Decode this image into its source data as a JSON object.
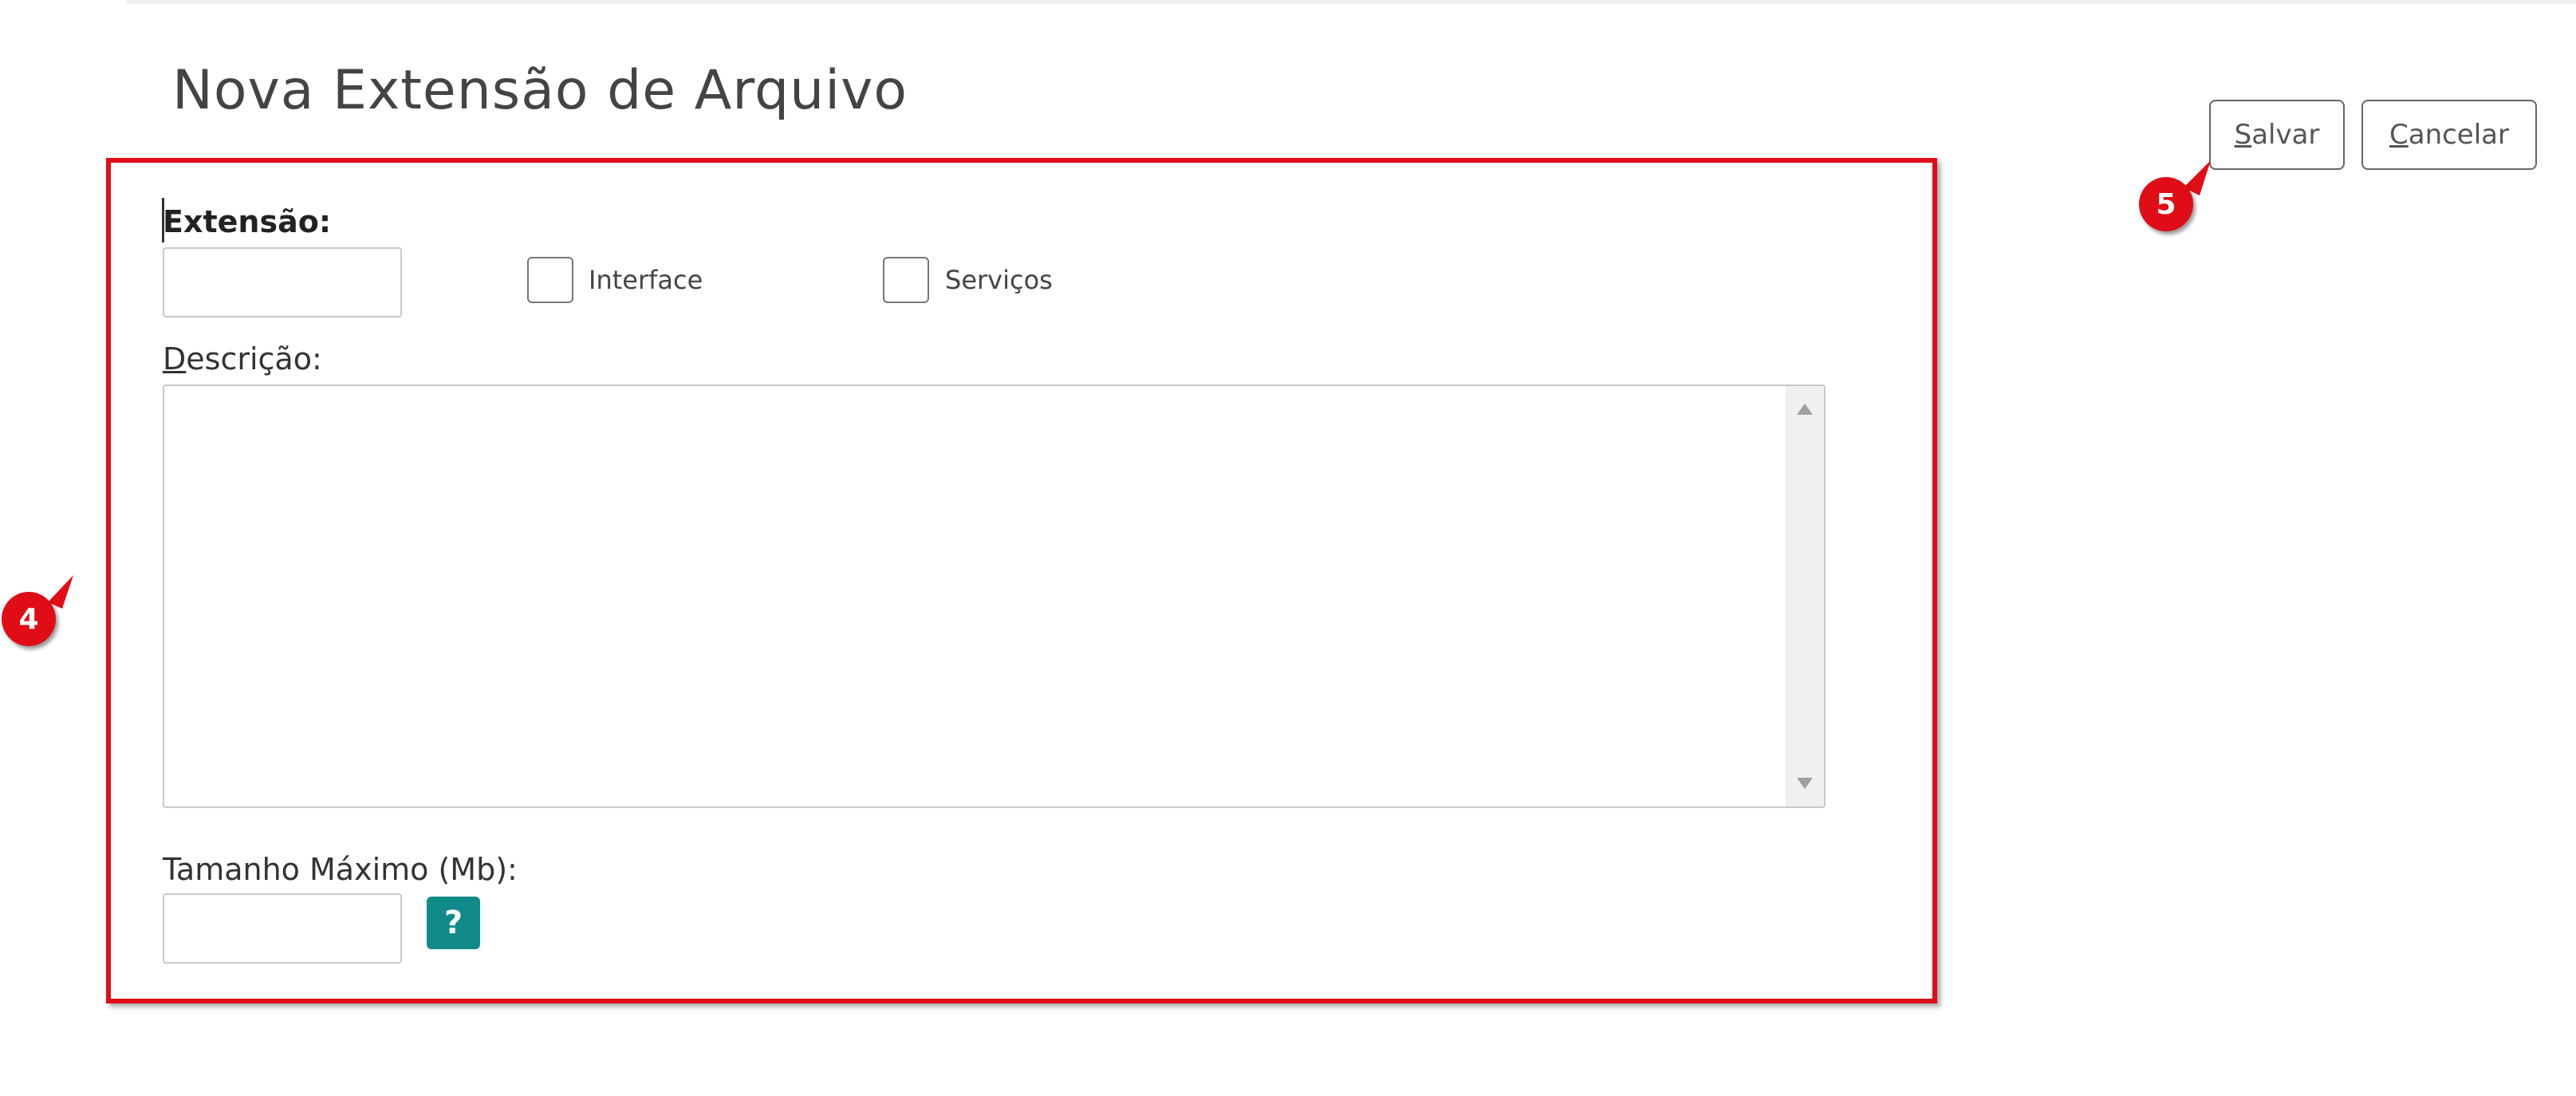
{
  "page": {
    "title": "Nova Extensão de Arquivo"
  },
  "toolbar": {
    "save_first": "S",
    "save_rest": "alvar",
    "cancel_first": "C",
    "cancel_rest": "ancelar"
  },
  "form": {
    "extension_label": "Extensão:",
    "extension_value": "",
    "interface_label": "Interface",
    "interface_checked": false,
    "services_label": "Serviços",
    "services_checked": false,
    "description_first": "D",
    "description_rest": "escrição:",
    "description_value": "",
    "max_size_label": "Tamanho Máximo (Mb):",
    "max_size_value": "",
    "help_symbol": "?"
  },
  "annotations": {
    "badge_4": "4",
    "badge_5": "5",
    "accent_color": "#e00d17",
    "help_color": "#118a8a"
  },
  "icons": {
    "help": "question-mark-icon",
    "scroll_up": "scroll-up-arrow-icon",
    "scroll_down": "scroll-down-arrow-icon"
  }
}
